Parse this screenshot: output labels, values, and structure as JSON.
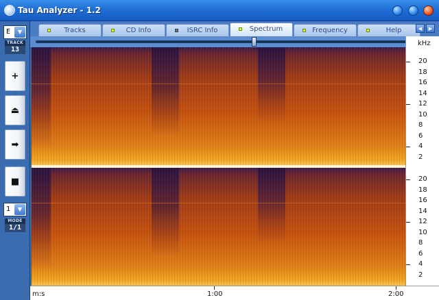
{
  "window": {
    "title": "Tau Analyzer - 1.2"
  },
  "left_panel": {
    "drive_value": "E",
    "track_label": "TRACK",
    "track_value": "13",
    "buttons": [
      {
        "name": "add",
        "glyph": "+"
      },
      {
        "name": "eject",
        "glyph": "⏏"
      },
      {
        "name": "play",
        "glyph": "➡"
      },
      {
        "name": "stop",
        "glyph": "■"
      }
    ],
    "mode_select_value": "1",
    "mode_label": "MODE",
    "mode_value": "1/1"
  },
  "tabs": [
    {
      "label": "Tracks",
      "led": "on",
      "active": false
    },
    {
      "label": "CD Info",
      "led": "on",
      "active": false
    },
    {
      "label": "ISRC Info",
      "led": "off",
      "active": false
    },
    {
      "label": "Spectrum",
      "led": "on",
      "active": true
    },
    {
      "label": "Frequency",
      "led": "on",
      "active": false
    },
    {
      "label": "Help",
      "led": "on",
      "active": false
    }
  ],
  "slider": {
    "position_fraction": 0.59
  },
  "axes": {
    "y_unit": "kHz",
    "y_ticks": [
      "20",
      "18",
      "16",
      "14",
      "12",
      "10",
      "8",
      "6",
      "4",
      "2"
    ],
    "x_unit": "m:s",
    "x_ticks": [
      "1:00",
      "2:00"
    ]
  },
  "colors": {
    "accent": "#1f6fd6",
    "spectrum_dark": "#3a1a4a",
    "spectrum_mid": "#b8420c",
    "spectrum_bright": "#f2a21a"
  }
}
